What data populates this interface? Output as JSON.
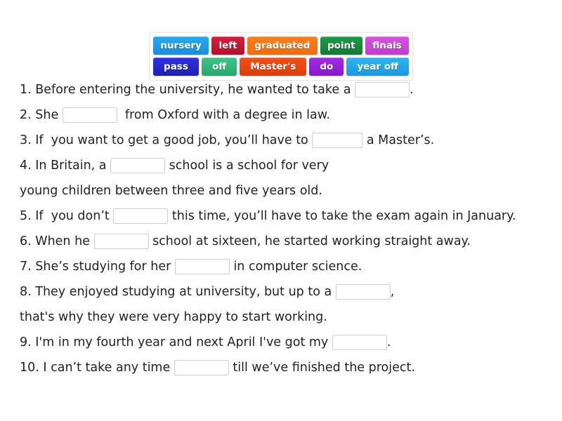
{
  "word_bank": {
    "rows": [
      [
        {
          "label": "nursery",
          "color_from": "#29a9ef",
          "color_to": "#1a8fe0"
        },
        {
          "label": "left",
          "color_from": "#d81e3f",
          "color_to": "#b3102c"
        },
        {
          "label": "graduated",
          "color_from": "#f98020",
          "color_to": "#f26c0b"
        },
        {
          "label": "point",
          "color_from": "#1e9a4a",
          "color_to": "#137a33"
        },
        {
          "label": "finals",
          "color_from": "#d653e0",
          "color_to": "#c23bd2"
        }
      ],
      [
        {
          "label": "pass",
          "color_from": "#3030dd",
          "color_to": "#2020b4"
        },
        {
          "label": "off",
          "color_from": "#3fc58c",
          "color_to": "#25a86e"
        },
        {
          "label": "Master's",
          "color_from": "#f0511a",
          "color_to": "#dd3d09"
        },
        {
          "label": "do",
          "color_from": "#a12ee0",
          "color_to": "#8a16cf"
        },
        {
          "label": "year off",
          "color_from": "#2fb3ef",
          "color_to": "#1a9ae2"
        }
      ]
    ]
  },
  "sentences": [
    {
      "id": "q1",
      "before": "1. Before entering the university, he wanted to take a ",
      "blank": true,
      "after": "."
    },
    {
      "id": "q2",
      "before": "2. She ",
      "blank": true,
      "after": "  from Oxford with a degree in law."
    },
    {
      "id": "q3",
      "before": "3. If  you want to get a good job, you’ll have to ",
      "blank": true,
      "after": " a Master’s."
    },
    {
      "id": "q4",
      "before": "4. In Britain, a ",
      "blank": true,
      "after": " school is a school for very"
    },
    {
      "id": "q4b",
      "before": "young children between three and five years old.",
      "blank": false,
      "after": ""
    },
    {
      "id": "q5",
      "before": "5. If  you don’t ",
      "blank": true,
      "after": " this time, you’ll have to take the exam again in January."
    },
    {
      "id": "q6",
      "before": "6. When he ",
      "blank": true,
      "after": " school at sixteen, he started working straight away."
    },
    {
      "id": "q7",
      "before": "7. She’s studying for her ",
      "blank": true,
      "after": " in computer science."
    },
    {
      "id": "q8",
      "before": "8. They enjoyed studying at university, but up to a ",
      "blank": true,
      "after": ","
    },
    {
      "id": "q8b",
      "before": "that's why they were very happy to start working.",
      "blank": false,
      "after": ""
    },
    {
      "id": "q9",
      "before": "9. I'm in my fourth year and next April I've got my ",
      "blank": true,
      "after": "."
    },
    {
      "id": "q10",
      "before": "10. I can’t take any time ",
      "blank": true,
      "after": " till we’ve finished the project."
    }
  ]
}
